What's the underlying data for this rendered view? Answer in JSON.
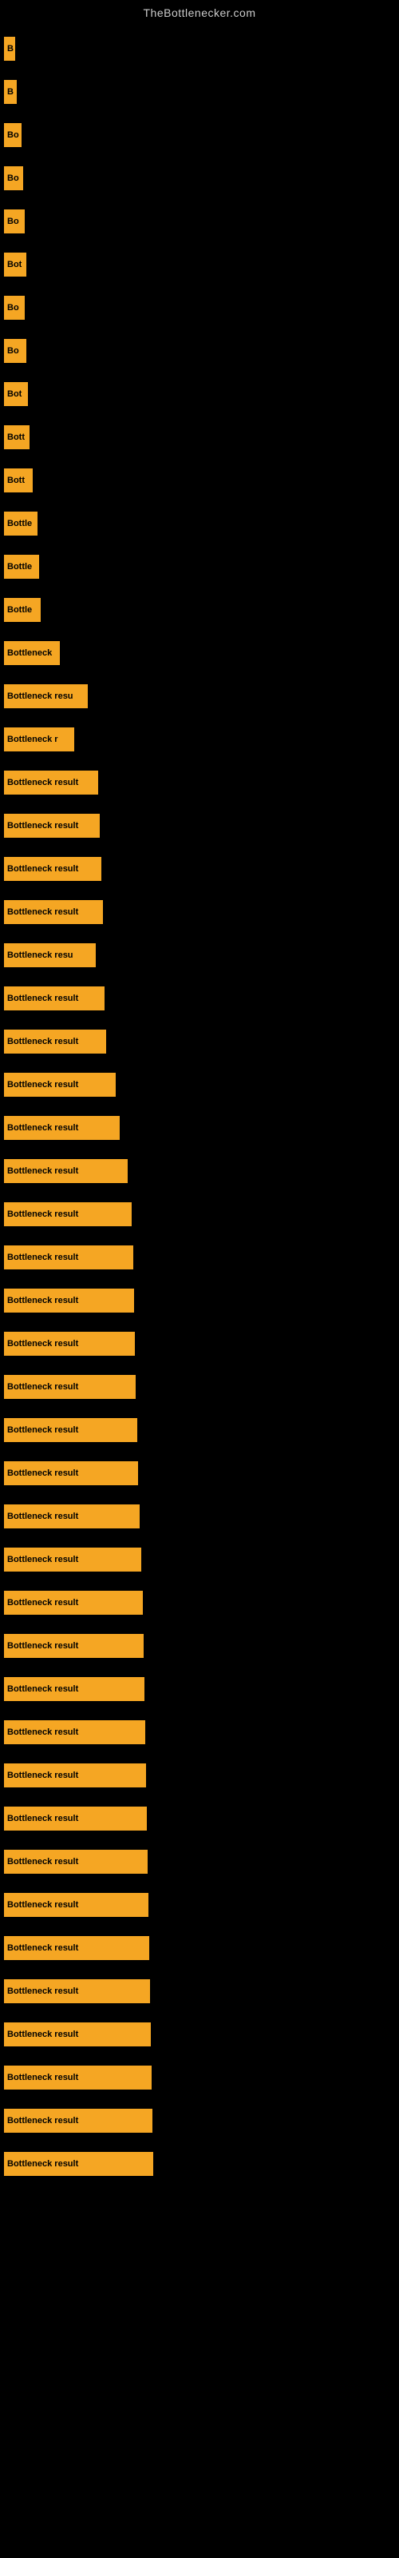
{
  "site": {
    "title": "TheBottlenecker.com"
  },
  "bars": [
    {
      "id": 1,
      "label": "B",
      "width": 14
    },
    {
      "id": 2,
      "label": "B",
      "width": 16
    },
    {
      "id": 3,
      "label": "Bo",
      "width": 22
    },
    {
      "id": 4,
      "label": "Bo",
      "width": 24
    },
    {
      "id": 5,
      "label": "Bo",
      "width": 26
    },
    {
      "id": 6,
      "label": "Bot",
      "width": 28
    },
    {
      "id": 7,
      "label": "Bo",
      "width": 26
    },
    {
      "id": 8,
      "label": "Bo",
      "width": 28
    },
    {
      "id": 9,
      "label": "Bot",
      "width": 30
    },
    {
      "id": 10,
      "label": "Bott",
      "width": 32
    },
    {
      "id": 11,
      "label": "Bott",
      "width": 36
    },
    {
      "id": 12,
      "label": "Bottle",
      "width": 42
    },
    {
      "id": 13,
      "label": "Bottle",
      "width": 44
    },
    {
      "id": 14,
      "label": "Bottle",
      "width": 46
    },
    {
      "id": 15,
      "label": "Bottleneck",
      "width": 70
    },
    {
      "id": 16,
      "label": "Bottleneck resu",
      "width": 105
    },
    {
      "id": 17,
      "label": "Bottleneck r",
      "width": 88
    },
    {
      "id": 18,
      "label": "Bottleneck result",
      "width": 118
    },
    {
      "id": 19,
      "label": "Bottleneck result",
      "width": 120
    },
    {
      "id": 20,
      "label": "Bottleneck result",
      "width": 122
    },
    {
      "id": 21,
      "label": "Bottleneck result",
      "width": 124
    },
    {
      "id": 22,
      "label": "Bottleneck resu",
      "width": 115
    },
    {
      "id": 23,
      "label": "Bottleneck result",
      "width": 126
    },
    {
      "id": 24,
      "label": "Bottleneck result",
      "width": 128
    },
    {
      "id": 25,
      "label": "Bottleneck result",
      "width": 140
    },
    {
      "id": 26,
      "label": "Bottleneck result",
      "width": 145
    },
    {
      "id": 27,
      "label": "Bottleneck result",
      "width": 155
    },
    {
      "id": 28,
      "label": "Bottleneck result",
      "width": 160
    },
    {
      "id": 29,
      "label": "Bottleneck result",
      "width": 162
    },
    {
      "id": 30,
      "label": "Bottleneck result",
      "width": 163
    },
    {
      "id": 31,
      "label": "Bottleneck result",
      "width": 164
    },
    {
      "id": 32,
      "label": "Bottleneck result",
      "width": 165
    },
    {
      "id": 33,
      "label": "Bottleneck result",
      "width": 167
    },
    {
      "id": 34,
      "label": "Bottleneck result",
      "width": 168
    },
    {
      "id": 35,
      "label": "Bottleneck result",
      "width": 170
    },
    {
      "id": 36,
      "label": "Bottleneck result",
      "width": 172
    },
    {
      "id": 37,
      "label": "Bottleneck result",
      "width": 174
    },
    {
      "id": 38,
      "label": "Bottleneck result",
      "width": 175
    },
    {
      "id": 39,
      "label": "Bottleneck result",
      "width": 176
    },
    {
      "id": 40,
      "label": "Bottleneck result",
      "width": 177
    },
    {
      "id": 41,
      "label": "Bottleneck result",
      "width": 178
    },
    {
      "id": 42,
      "label": "Bottleneck result",
      "width": 179
    },
    {
      "id": 43,
      "label": "Bottleneck result",
      "width": 180
    },
    {
      "id": 44,
      "label": "Bottleneck result",
      "width": 181
    },
    {
      "id": 45,
      "label": "Bottleneck result",
      "width": 182
    },
    {
      "id": 46,
      "label": "Bottleneck result",
      "width": 183
    },
    {
      "id": 47,
      "label": "Bottleneck result",
      "width": 184
    },
    {
      "id": 48,
      "label": "Bottleneck result",
      "width": 185
    },
    {
      "id": 49,
      "label": "Bottleneck result",
      "width": 186
    },
    {
      "id": 50,
      "label": "Bottleneck result",
      "width": 187
    }
  ]
}
